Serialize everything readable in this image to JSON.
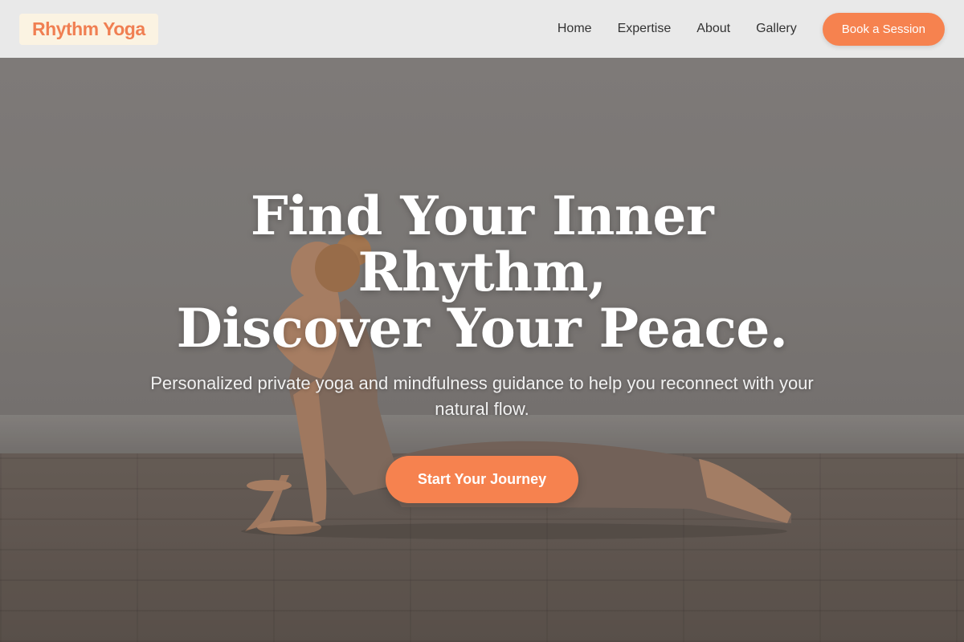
{
  "brand": {
    "name": "Rhythm Yoga"
  },
  "nav": {
    "links": [
      "Home",
      "Expertise",
      "About",
      "Gallery"
    ],
    "cta_label": "Book a Session"
  },
  "hero": {
    "headline_line1": "Find Your Inner Rhythm,",
    "headline_line2": "Discover Your Peace.",
    "subheadline": "Personalized private yoga and mindfulness guidance to help you reconnect with your natural flow.",
    "cta_label": "Start Your Journey",
    "image_subject": "woman in cobra pose on wooden floor"
  },
  "colors": {
    "accent": "#f6824f",
    "logo_text": "#f07f52",
    "logo_bg": "#fbf3e2",
    "nav_bg": "#e9e9e9"
  }
}
